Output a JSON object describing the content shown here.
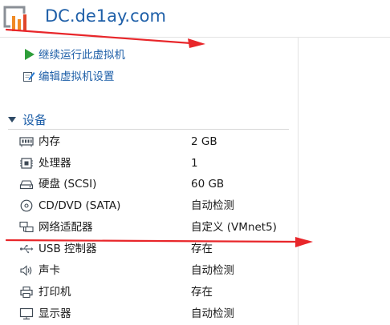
{
  "header": {
    "title": "DC.de1ay.com",
    "logo_icon": "vmware-logo-icon"
  },
  "actions": [
    {
      "label": "继续运行此虚拟机",
      "icon": "play-icon"
    },
    {
      "label": "编辑虚拟机设置",
      "icon": "edit-settings-icon"
    }
  ],
  "devices_section": {
    "title": "设备",
    "items": [
      {
        "name": "内存",
        "value": "2 GB",
        "icon": "memory-icon"
      },
      {
        "name": "处理器",
        "value": "1",
        "icon": "processor-icon"
      },
      {
        "name": "硬盘 (SCSI)",
        "value": "60 GB",
        "icon": "harddisk-icon"
      },
      {
        "name": "CD/DVD (SATA)",
        "value": "自动检测",
        "icon": "cd-dvd-icon"
      },
      {
        "name": "网络适配器",
        "value": "自定义 (VMnet5)",
        "icon": "network-adapter-icon"
      },
      {
        "name": "USB 控制器",
        "value": "存在",
        "icon": "usb-icon"
      },
      {
        "name": "声卡",
        "value": "自动检测",
        "icon": "sound-card-icon"
      },
      {
        "name": "打印机",
        "value": "存在",
        "icon": "printer-icon"
      },
      {
        "name": "显示器",
        "value": "自动检测",
        "icon": "display-icon"
      }
    ]
  },
  "colors": {
    "accent": "#1e5fa8",
    "play_green": "#2e9e3a",
    "annotation_red": "#e8262a"
  }
}
